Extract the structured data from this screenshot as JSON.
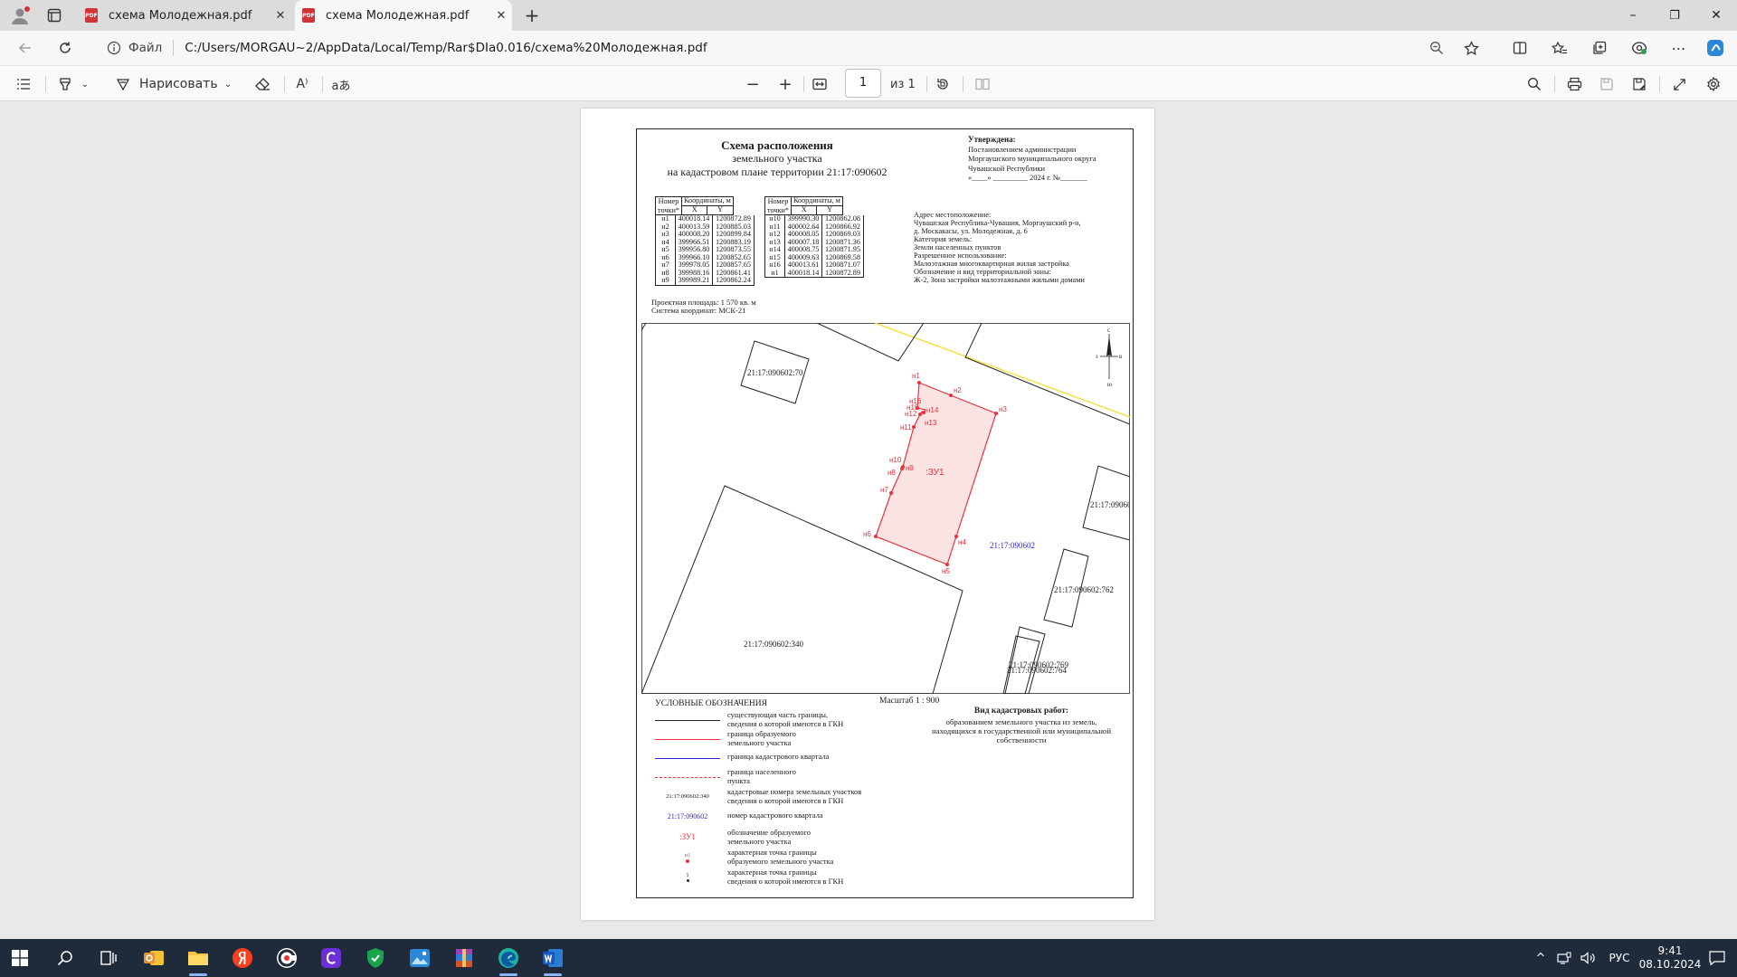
{
  "browser": {
    "tabs": [
      {
        "label": "схема Молодежная.pdf",
        "close": "✕"
      },
      {
        "label": "схема Молодежная.pdf",
        "close": "✕"
      }
    ],
    "new_tab": "+",
    "window_controls": {
      "minimize": "–",
      "restore": "❐",
      "close": "✕"
    },
    "address": {
      "scheme_label": "Файл",
      "url": "C:/Users/MORGAU~2/AppData/Local/Temp/Rar$DIa0.016/схема%20Молодежная.pdf"
    }
  },
  "pdf_toolbar": {
    "draw_label": "Нарисовать",
    "read_aloud": "A⁾",
    "translate": "aあ",
    "zoom_out": "−",
    "zoom_in": "+",
    "page_current": "1",
    "page_total": "из 1"
  },
  "document": {
    "title_line1": "Схема расположения",
    "title_line2": "земельного участка",
    "title_line3": "на кадастровом плане территории 21:17:090602",
    "approved_head": "Утверждена:",
    "approved_lines": [
      "Постановлением администрации",
      "Моргаушского муниципального округа",
      "Чувашской Республики",
      "«____» _________ 2024 г. №_______"
    ],
    "table_headers": {
      "point_no_1": "Номер",
      "point_no_2": "точки*",
      "coords": "Координаты, м",
      "x": "X",
      "y": "Y"
    },
    "points_left": [
      [
        "н1",
        "400018.14",
        "1200872.89"
      ],
      [
        "н2",
        "400013.59",
        "1200885.03"
      ],
      [
        "н3",
        "400008.20",
        "1200899.84"
      ],
      [
        "н4",
        "399966.51",
        "1200883.19"
      ],
      [
        "н5",
        "399956.80",
        "1200873.55"
      ],
      [
        "н6",
        "399966.10",
        "1200852.65"
      ],
      [
        "н7",
        "399978.05",
        "1200857.65"
      ],
      [
        "н8",
        "399988.16",
        "1200861.41"
      ],
      [
        "н9",
        "399989.21",
        "1200862.24"
      ]
    ],
    "points_right": [
      [
        "н10",
        "399990.30",
        "1200862.08"
      ],
      [
        "н11",
        "400002.64",
        "1200866.92"
      ],
      [
        "н12",
        "400008.05",
        "1200869.03"
      ],
      [
        "н13",
        "400007.18",
        "1200871.36"
      ],
      [
        "н14",
        "400008.75",
        "1200871.95"
      ],
      [
        "н15",
        "400009.63",
        "1200869.58"
      ],
      [
        "н16",
        "400013.61",
        "1200871.07"
      ],
      [
        "н1",
        "400018.14",
        "1200872.89"
      ]
    ],
    "address_lines": [
      "Адрес местоположение:",
      "Чувашская Республика-Чувашия, Моргаушский р-н,",
      "д. Москакасы, ул. Молодежная, д. 6",
      "Категория земель:",
      "Земли населенных пунктов",
      "Разрешенное использование:",
      "Малоэтажная многоквартирная жилая застройка",
      "Обозначение и вид территориальной зоны:",
      "Ж-2, Зона застройки малоэтажными жилыми домами"
    ],
    "area": "Проектная площадь: 1 570 кв. м",
    "crs": "Система координат:  МСК-21",
    "map": {
      "parcel_70": "21:17:090602:70",
      "parcel_340": "21:17:090602:340",
      "parcel_762": "21:17:090602:762",
      "parcel_right": "21:17:09060",
      "parcel_769": "21:17:090602:769",
      "parcel_764": "21:17:090602:764",
      "quarter": "21:17:090602",
      "zu": ":ЗУ1",
      "compass_n": "С",
      "compass_s": "Ю",
      "compass_w": "З",
      "compass_e": "В",
      "point_labels": [
        "н1",
        "н2",
        "н3",
        "н4",
        "н5",
        "н6",
        "н7",
        "н8",
        "н9",
        "н10",
        "н11",
        "н12",
        "н13",
        "н14",
        "н15",
        "н16"
      ]
    },
    "legend_title": "УСЛОВНЫЕ ОБОЗНАЧЕНИЯ",
    "scale": "Масштаб 1 : 900",
    "works_title": "Вид кадастровых работ:",
    "works_lines": [
      "образованием земельного участка из земель,",
      "находящихся в государственной или муниципальной",
      "собственности"
    ],
    "legend": [
      {
        "t1": "существующая часть границы,",
        "t2": "сведения о которой имеются в ГКН"
      },
      {
        "t1": "граница образуемого",
        "t2": "земельного участка"
      },
      {
        "t1": "граница кадастрового квартала",
        "t2": ""
      },
      {
        "t1": "граница населенного",
        "t2": "пункта"
      },
      {
        "t1": "кадастровые номера земельных участков",
        "t2": "сведения о которой имеются в ГКН",
        "sym": "21:17:090602:340"
      },
      {
        "t1": "номер кадастрового квартала",
        "t2": "",
        "sym": "21:17:090602"
      },
      {
        "t1": "обозначение образуемого",
        "t2": "земельного участка",
        "sym": ":ЗУ1"
      },
      {
        "t1": "характерная точка границы",
        "t2": "образуемого земельного участка",
        "sym": "н1"
      },
      {
        "t1": "характерная точка границы",
        "t2": "сведения о которой имеются в ГКН",
        "sym": "1"
      }
    ]
  },
  "taskbar": {
    "lang": "РУС",
    "time": "9:41",
    "date": "08.10.2024"
  },
  "colors": {
    "red": "#e8323c",
    "blue": "#2b2bd6",
    "yellow": "#f3e24a",
    "zu_fill": "#fbe3e3"
  }
}
